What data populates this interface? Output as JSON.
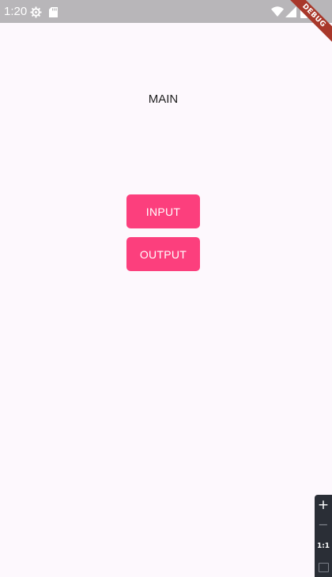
{
  "status_bar": {
    "time": "1:20",
    "background_color": "#b8b6b9",
    "icons": [
      "settings-gear-icon",
      "sd-card-icon",
      "wifi-icon",
      "signal-icon",
      "battery-icon"
    ]
  },
  "debug_banner": {
    "label": "DEBUG",
    "color": "#a8372a"
  },
  "main": {
    "title": "MAIN",
    "background_color": "#fdf8fd"
  },
  "buttons": {
    "input_label": "INPUT",
    "output_label": "OUTPUT",
    "color": "#fc3f7d"
  },
  "zoom_controls": {
    "zoom_in_label": "+",
    "zoom_out_label": "−",
    "actual_size_label": "1:1",
    "icons": [
      "plus-icon",
      "minus-icon",
      "fit-screen-icon"
    ]
  }
}
